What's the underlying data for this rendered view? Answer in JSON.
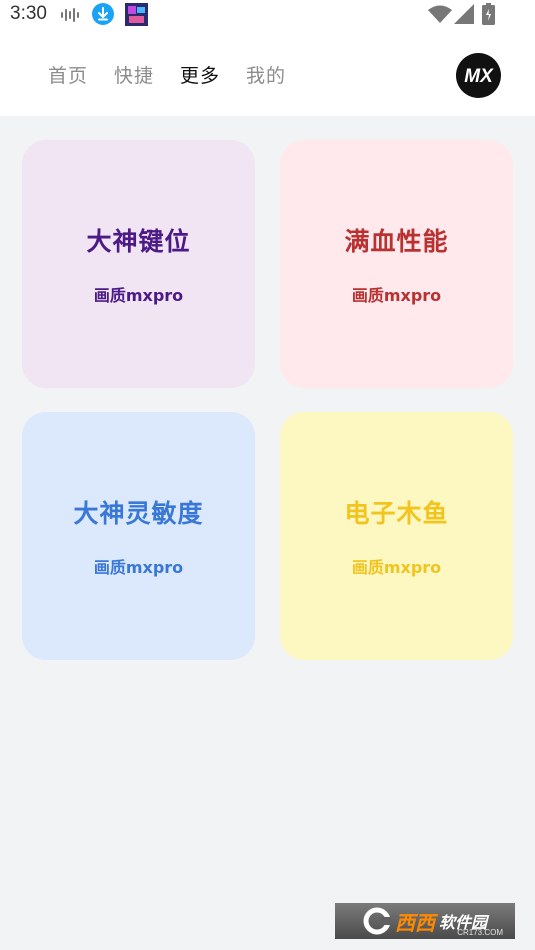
{
  "status_bar": {
    "time": "3:30",
    "left_icons": [
      "audio-wave-icon",
      "download-icon",
      "app-thumbnail-icon"
    ],
    "right_icons": [
      "wifi-icon",
      "signal-icon",
      "battery-icon"
    ]
  },
  "header": {
    "tabs": [
      {
        "label": "首页",
        "active": false
      },
      {
        "label": "快捷",
        "active": false
      },
      {
        "label": "更多",
        "active": true
      },
      {
        "label": "我的",
        "active": false
      }
    ],
    "avatar_text": "MX"
  },
  "cards": [
    {
      "title": "大神键位",
      "subtitle": "画质mxpro",
      "bg": "#f1e4f3",
      "color": "#4b1a86"
    },
    {
      "title": "满血性能",
      "subtitle": "画质mxpro",
      "bg": "#ffe9ec",
      "color": "#b83232"
    },
    {
      "title": "大神灵敏度",
      "subtitle": "画质mxpro",
      "bg": "#dce9fd",
      "color": "#3a78d8"
    },
    {
      "title": "电子木鱼",
      "subtitle": "画质mxpro",
      "bg": "#fdf7c2",
      "color": "#f2c51e"
    }
  ],
  "watermark": {
    "main": "西西",
    "text": "软件园",
    "url": "CR173.COM"
  }
}
